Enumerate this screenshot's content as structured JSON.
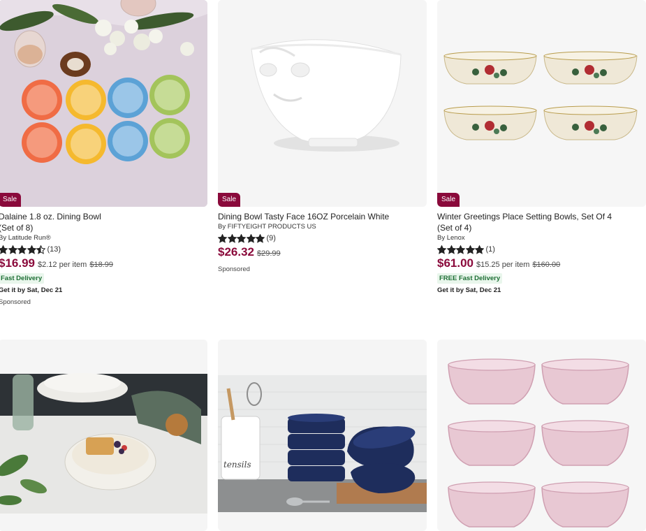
{
  "products": [
    {
      "sale_badge": "Sale",
      "title_line1": "Dalaine 1.8 oz. Dining Bowl",
      "title_line2": "(Set of 8)",
      "brand": "By Latitude Run®",
      "rating_count": "(13)",
      "rating": 4.5,
      "price": "$16.99",
      "per_item": "$2.12 per item",
      "original_price": "$18.99",
      "delivery_badge": "Fast Delivery",
      "delivery_date": "Get it by Sat, Dec 21",
      "sponsored": "Sponsored"
    },
    {
      "sale_badge": "Sale",
      "title_line1": "Dining Bowl Tasty Face 16OZ Porcelain White",
      "brand": "By FIFTYEIGHT PRODUCTS US",
      "rating_count": "(9)",
      "rating": 5,
      "price": "$26.32",
      "original_price": "$29.99",
      "sponsored": "Sponsored"
    },
    {
      "sale_badge": "Sale",
      "title_line1": "Winter Greetings Place Setting Bowls, Set Of 4",
      "title_line2": "(Set of 4)",
      "brand": "By Lenox",
      "rating_count": "(1)",
      "rating": 5,
      "price": "$61.00",
      "per_item": "$15.25 per item",
      "original_price": "$160.00",
      "delivery_badge": "FREE Fast Delivery",
      "delivery_date": "Get it by Sat, Dec 21"
    }
  ],
  "colors": {
    "sale": "#8a0a3b",
    "delivery_green": "#1d6e34",
    "delivery_bg": "#e9f6ec"
  }
}
